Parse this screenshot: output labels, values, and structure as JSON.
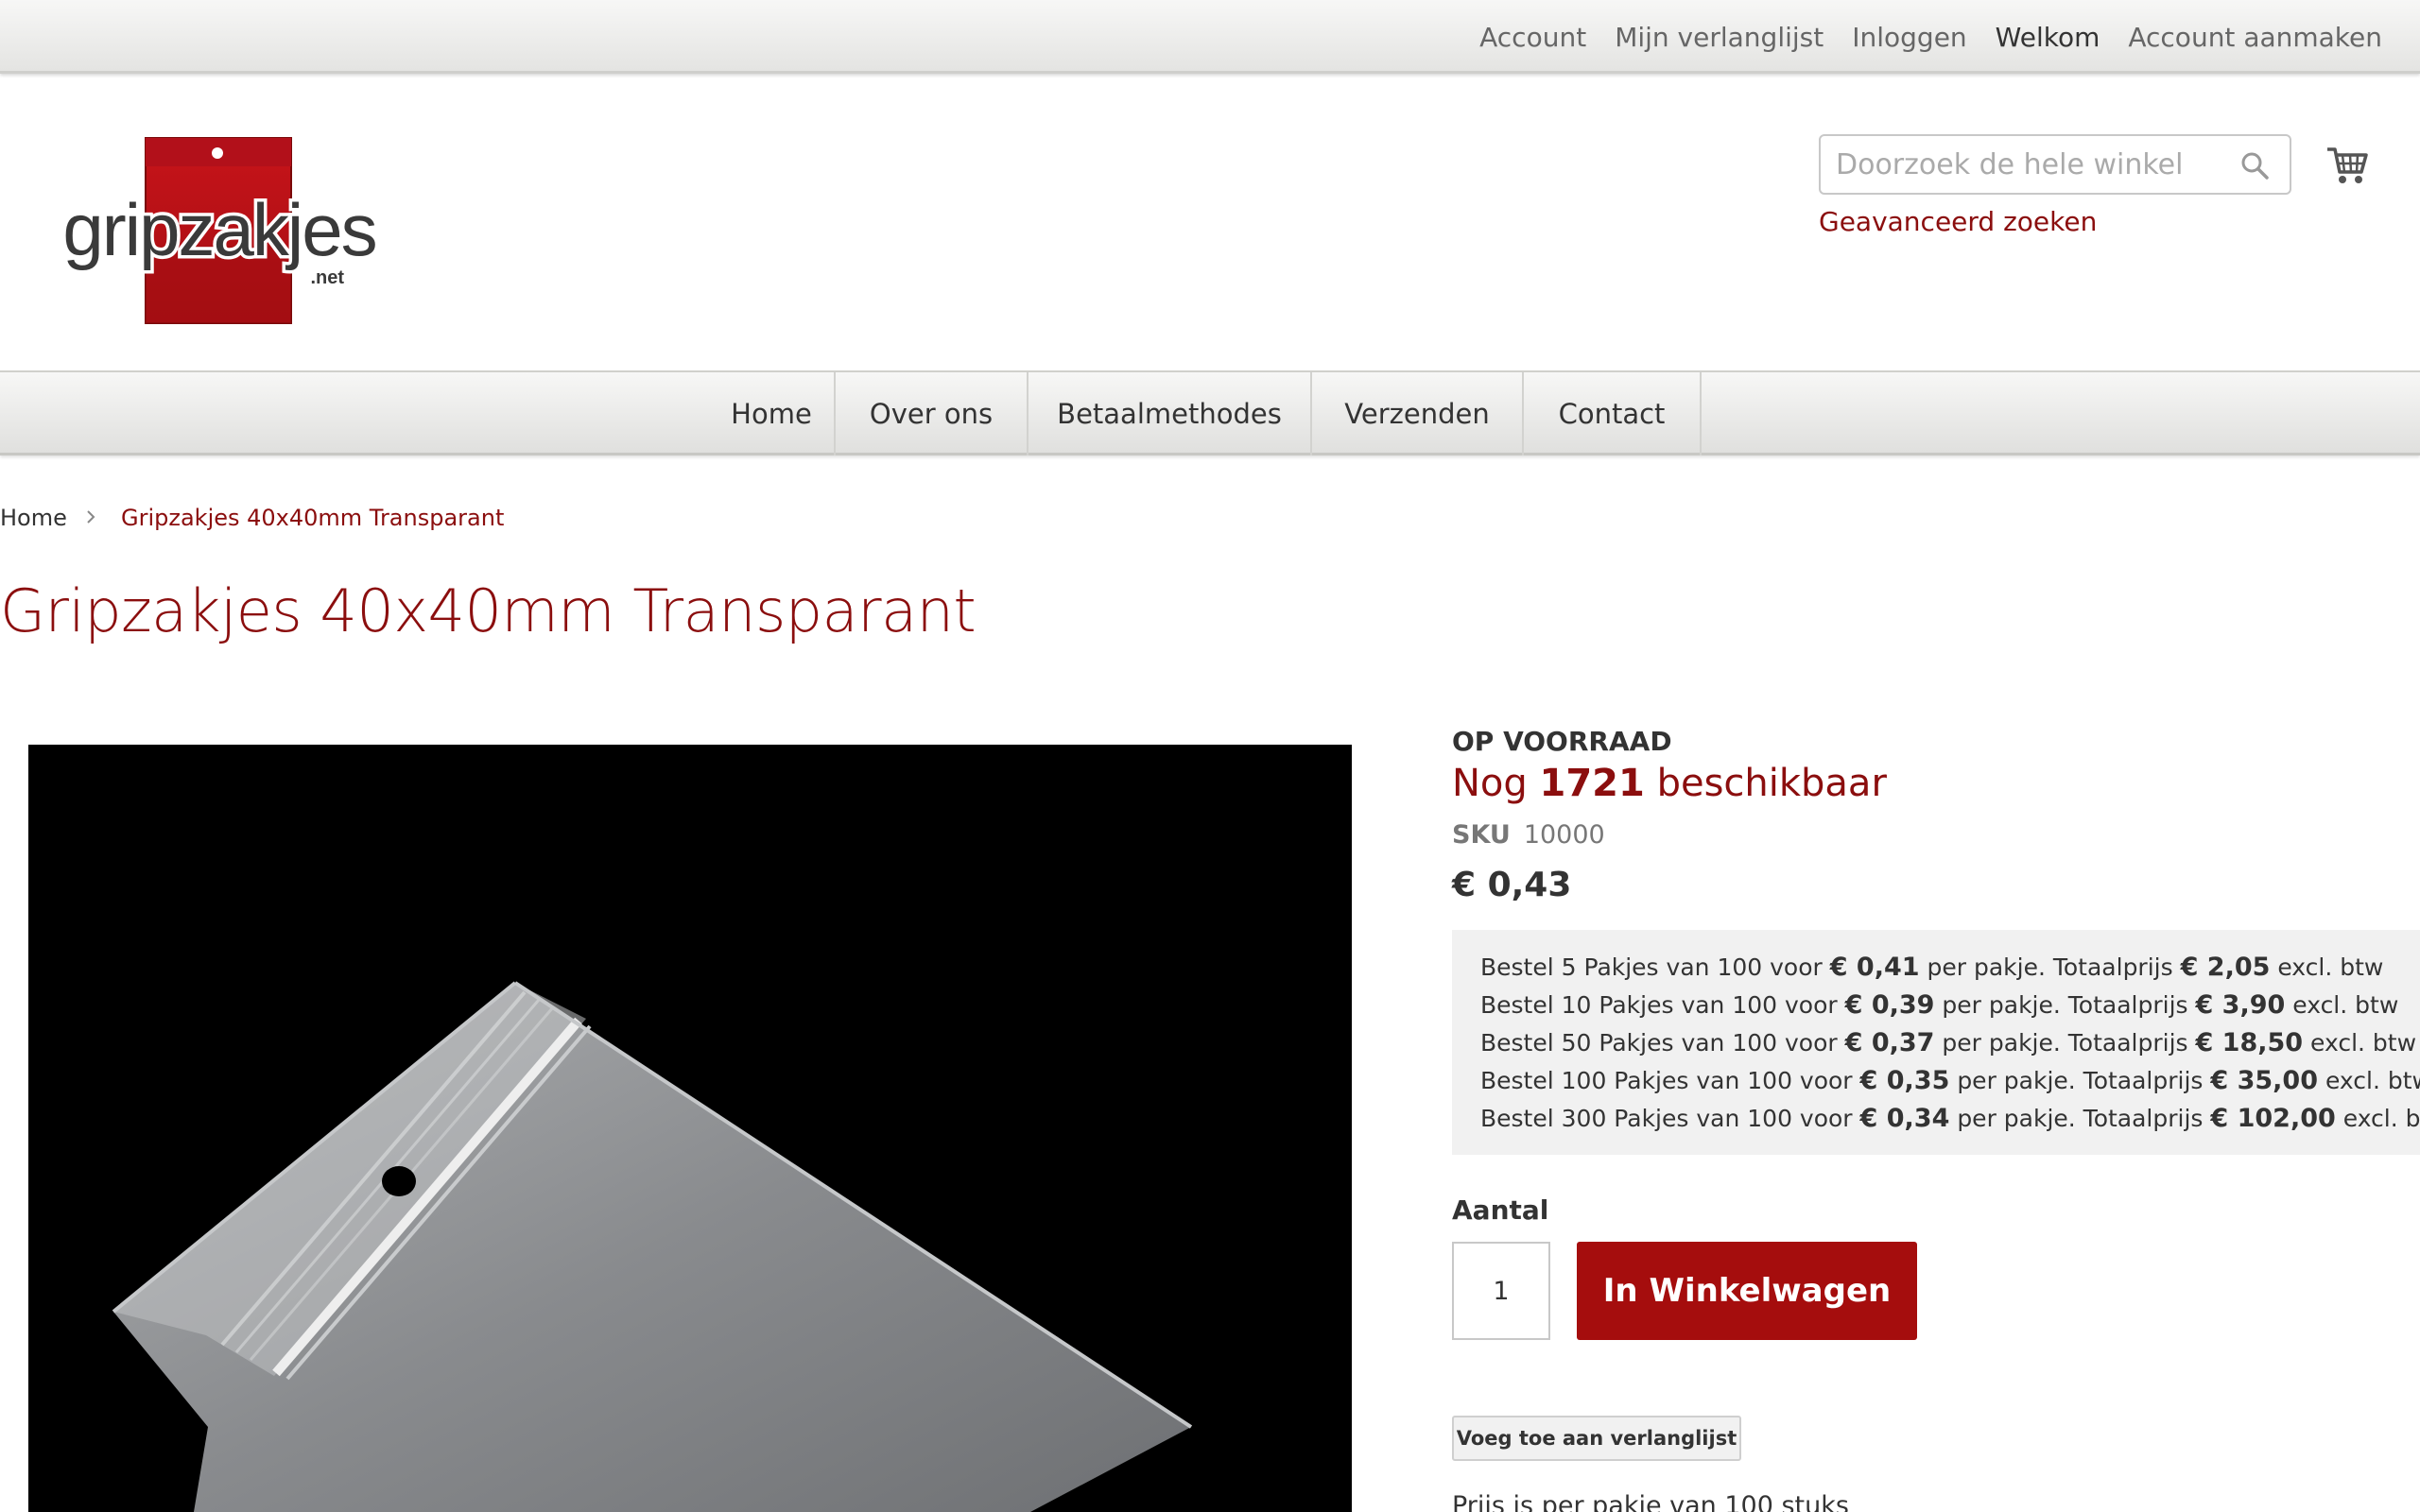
{
  "top_links": {
    "account": "Account",
    "wishlist": "Mijn verlanglijst",
    "login": "Inloggen",
    "welcome": "Welkom",
    "create_account": "Account aanmaken"
  },
  "logo": {
    "text": "gripzakjes",
    "suffix": ".net"
  },
  "search": {
    "placeholder": "Doorzoek de hele winkel",
    "advanced_label": "Geavanceerd zoeken"
  },
  "nav": {
    "items": [
      {
        "label": "Home"
      },
      {
        "label": "Over ons"
      },
      {
        "label": "Betaalmethodes"
      },
      {
        "label": "Verzenden"
      },
      {
        "label": "Contact"
      }
    ]
  },
  "breadcrumb": {
    "home": "Home",
    "current": "Gripzakjes 40x40mm Transparant"
  },
  "product": {
    "title": "Gripzakjes 40x40mm Transparant",
    "stock_status": "OP VOORRAAD",
    "stock_prefix": "Nog",
    "stock_count": "1721",
    "stock_suffix": "beschikbaar",
    "sku_label": "SKU",
    "sku_value": "10000",
    "price": "€ 0,43",
    "tier_prices": [
      {
        "prefix": "Bestel 5 Pakjes van 100 voor",
        "unit_price": "€ 0,41",
        "middle": "per pakje. Totaalprijs",
        "total": "€ 2,05",
        "suffix": "excl. btw"
      },
      {
        "prefix": "Bestel 10 Pakjes van 100 voor",
        "unit_price": "€ 0,39",
        "middle": "per pakje. Totaalprijs",
        "total": "€ 3,90",
        "suffix": "excl. btw"
      },
      {
        "prefix": "Bestel 50 Pakjes van 100 voor",
        "unit_price": "€ 0,37",
        "middle": "per pakje. Totaalprijs",
        "total": "€ 18,50",
        "suffix": "excl. btw"
      },
      {
        "prefix": "Bestel 100 Pakjes van 100 voor",
        "unit_price": "€ 0,35",
        "middle": "per pakje. Totaalprijs",
        "total": "€ 35,00",
        "suffix": "excl. btw"
      },
      {
        "prefix": "Bestel 300 Pakjes van 100 voor",
        "unit_price": "€ 0,34",
        "middle": "per pakje. Totaalprijs",
        "total": "€ 102,00",
        "suffix": "excl. btw"
      }
    ],
    "qty_label": "Aantal",
    "qty_value": "1",
    "add_to_cart_label": "In Winkelwagen",
    "add_to_wishlist_label": "Voeg toe aan verlanglijst",
    "truncated_text": "Prijs is per pakje van 100 stuks"
  },
  "colors": {
    "brand_red": "#8b0e0e",
    "button_red": "#a50d0d",
    "tier_bg": "#f1f1f1"
  },
  "icons": {
    "search": "search-icon",
    "cart": "shopping-cart-icon",
    "breadcrumb_separator": "chevron-right-icon"
  }
}
